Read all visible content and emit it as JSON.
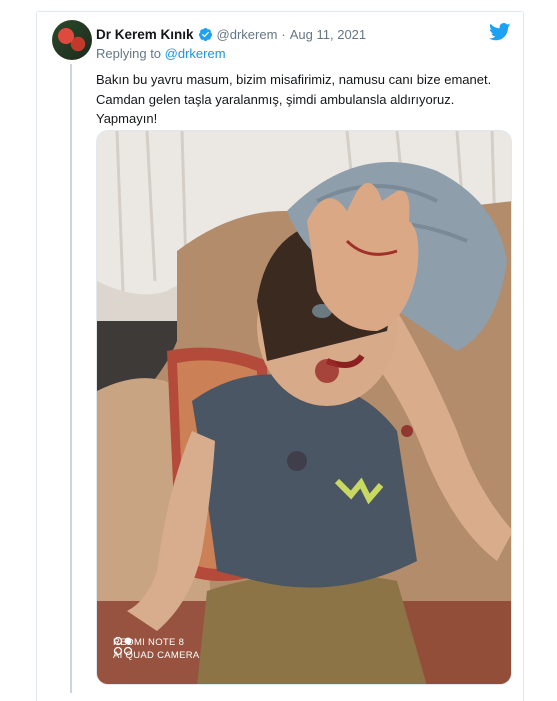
{
  "tweet": {
    "author_name": "Dr Kerem Kınık",
    "author_handle": "@drkerem",
    "separator": "·",
    "date": "Aug 11, 2021",
    "reply_prefix": "Replying to",
    "reply_mention": "@drkerem",
    "text_lines": [
      "Bakın bu yavru masum, bizim misafirimiz, namusu canı bize emanet.",
      "Camdan gelen taşla yaralanmış, şimdi ambulansla aldırıyoruz.",
      "Yapmayın!"
    ],
    "photo_watermark": {
      "line1": "REDMI NOTE 8",
      "line2": "AI QUAD CAMERA"
    }
  },
  "colors": {
    "accent": "#1da1f2",
    "link": "#1b95e0",
    "secondary_text": "#657786",
    "primary_text": "#14171a",
    "border": "#e1e8ed"
  },
  "icons": {
    "verified": "verified-badge-icon",
    "brand": "twitter-bird-icon",
    "camera": "camera-lens-icon"
  }
}
